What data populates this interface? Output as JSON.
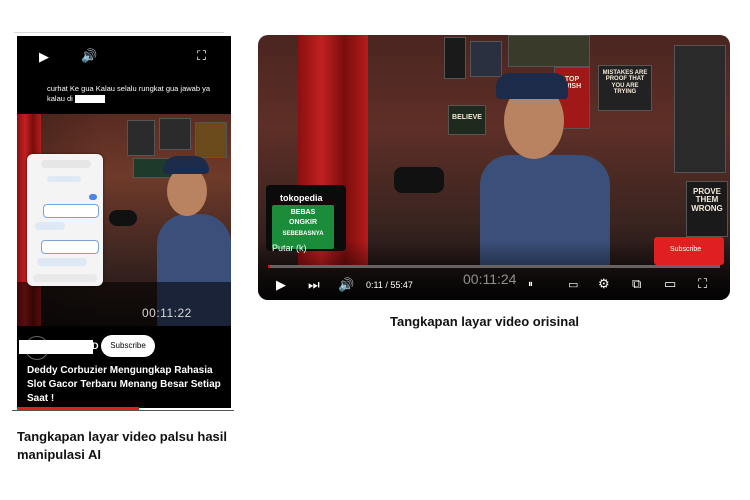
{
  "fake": {
    "caption_text": "curhat Ke gua Kalau selalu rungkat gua jawab ya kalau di",
    "timestamp": "00:11:22",
    "channel_suffix": "D",
    "subscribe_label": "Subscribe",
    "title": "Deddy Corbuzier Mengungkap Rahasia Slot Gacor Terbaru Menang Besar Setiap Saat !",
    "icons": [
      "play-icon",
      "volume-icon",
      "fullscreen-icon"
    ],
    "progress_fraction": 0.57
  },
  "original": {
    "time_display": "0:11 / 55:47",
    "overlay_timestamp": "00:11:24",
    "sponsor_brand": "tokopedia",
    "sponsor_line1": "BEBAS",
    "sponsor_line2": "ONGKIR",
    "sponsor_line3": "SEBEBASNYA",
    "putar_label": "Putar (k)",
    "subscribe_label": "Subscribe",
    "wall_signs": [
      "PROVE THEM WRONG",
      "MISTAKES ARE PROOF THAT YOU ARE TRYING",
      "TOP WISH",
      "BELIEVE"
    ],
    "icons": [
      "play-icon",
      "next-icon",
      "volume-icon",
      "autoplay-toggle-icon",
      "captions-icon",
      "settings-icon",
      "miniplayer-icon",
      "theater-icon",
      "fullscreen-icon"
    ],
    "progress_fraction": 0.003
  },
  "captions": {
    "left": "Tangkapan layar video palsu hasil manipulasi AI",
    "right": "Tangkapan layar video orisinal"
  },
  "colors": {
    "progress_red": "#e02020",
    "sponsor_green": "#1a8c3a"
  }
}
